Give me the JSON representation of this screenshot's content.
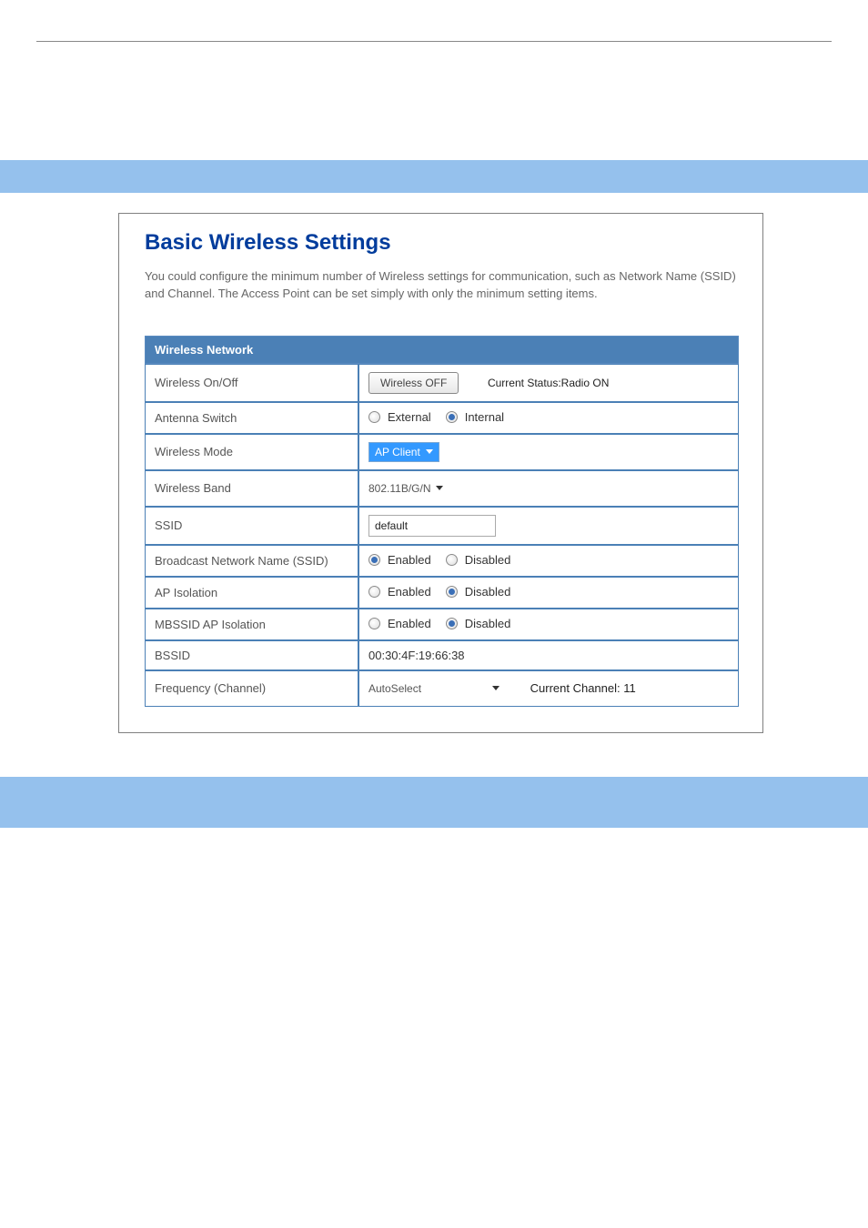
{
  "panel": {
    "title": "Basic Wireless Settings",
    "description": "You could configure the minimum number of Wireless settings for communication, such as Network Name (SSID) and Channel. The Access Point can be set simply with only the minimum setting items."
  },
  "section_header": "Wireless Network",
  "rows": {
    "wireless_onoff": {
      "label": "Wireless On/Off",
      "button": "Wireless OFF",
      "status": "Current Status:Radio ON"
    },
    "antenna_switch": {
      "label": "Antenna Switch",
      "opt_external": "External",
      "opt_internal": "Internal",
      "selected": "Internal"
    },
    "wireless_mode": {
      "label": "Wireless Mode",
      "value": "AP Client"
    },
    "wireless_band": {
      "label": "Wireless Band",
      "value": "802.11B/G/N"
    },
    "ssid": {
      "label": "SSID",
      "value": "default"
    },
    "broadcast_ssid": {
      "label": "Broadcast Network Name (SSID)",
      "opt_enabled": "Enabled",
      "opt_disabled": "Disabled",
      "selected": "Enabled"
    },
    "ap_isolation": {
      "label": "AP Isolation",
      "opt_enabled": "Enabled",
      "opt_disabled": "Disabled",
      "selected": "Disabled"
    },
    "mbssid_ap_isolation": {
      "label": "MBSSID AP Isolation",
      "opt_enabled": "Enabled",
      "opt_disabled": "Disabled",
      "selected": "Disabled"
    },
    "bssid": {
      "label": "BSSID",
      "value": "00:30:4F:19:66:38"
    },
    "frequency_channel": {
      "label": "Frequency (Channel)",
      "value": "AutoSelect",
      "current": "Current Channel: 11"
    }
  }
}
